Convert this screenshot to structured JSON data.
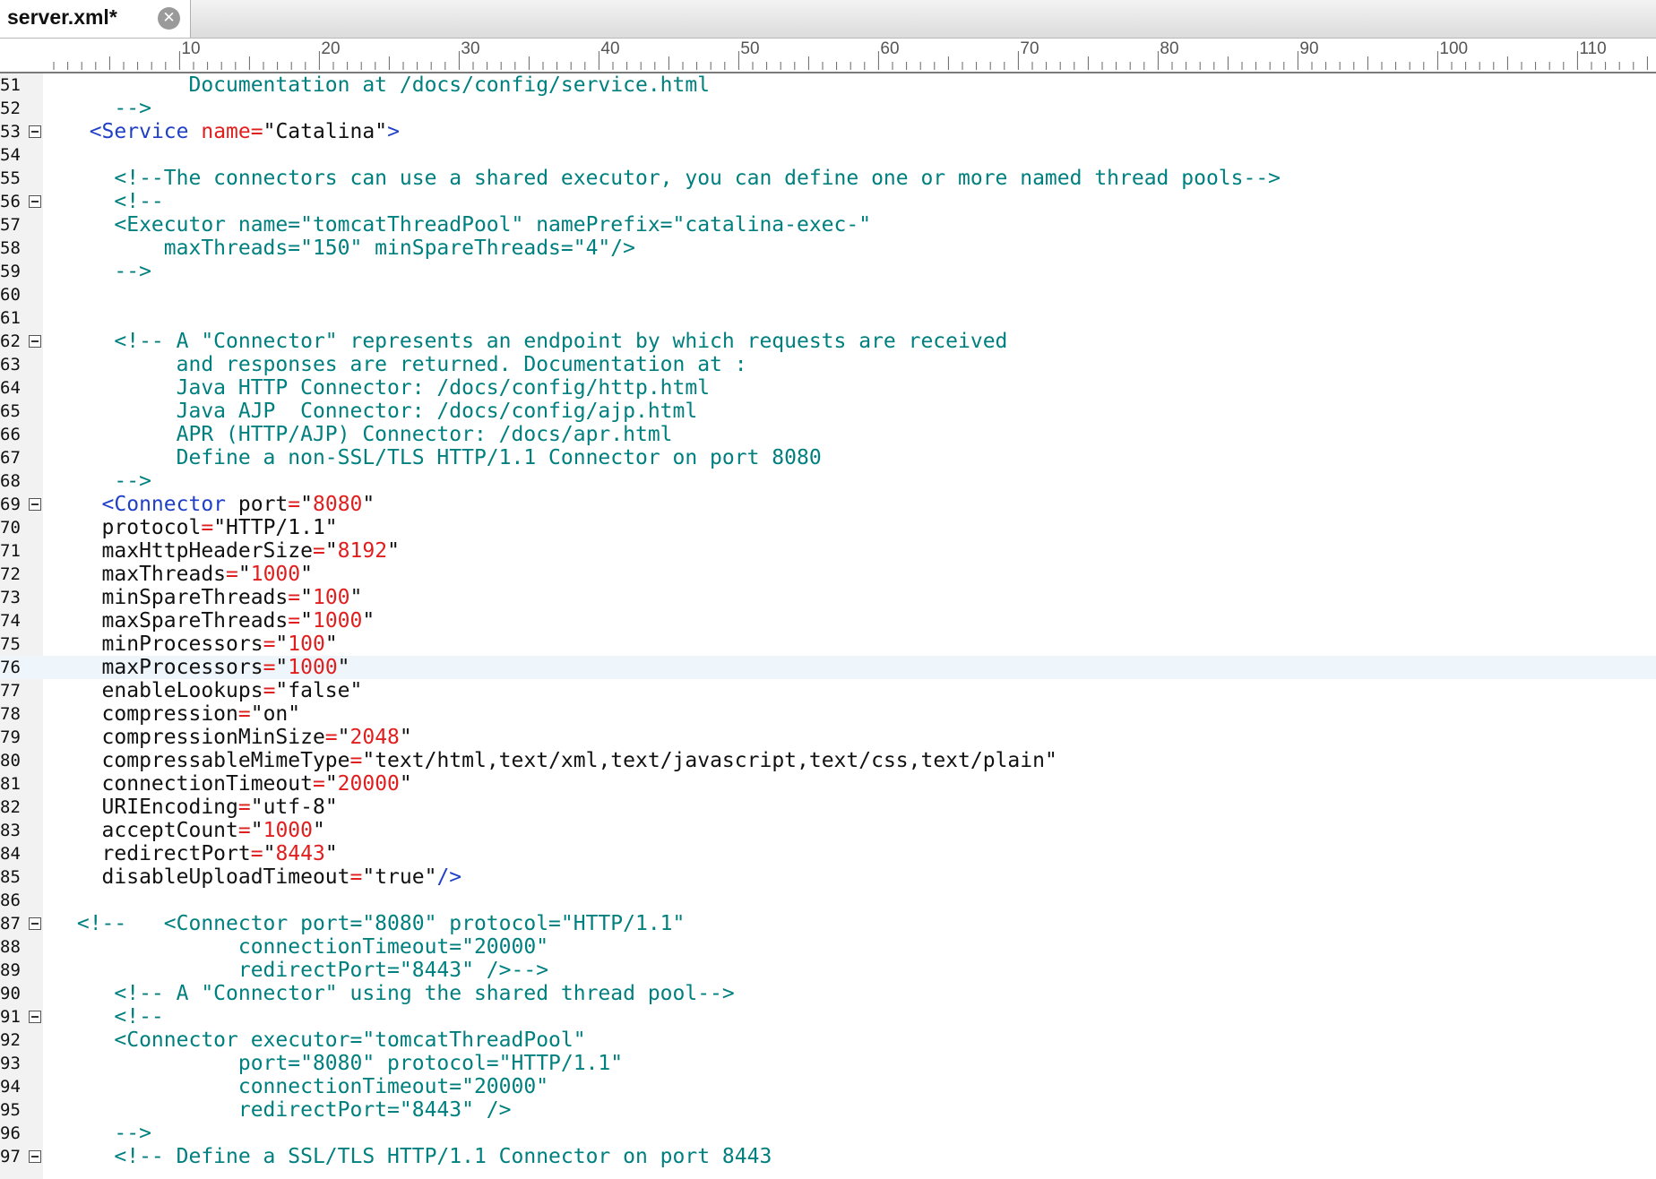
{
  "tab": {
    "title": "server.xml*",
    "close_icon": "close-icon"
  },
  "ruler": {
    "labels": [
      "10",
      "20",
      "30",
      "40",
      "50",
      "60",
      "70",
      "80",
      "90",
      "100",
      "110"
    ]
  },
  "colors": {
    "comment": "#007f7f",
    "tag": "#1f3fc7",
    "attribute_operator": "#e01e1e",
    "number": "#e01e1e",
    "text": "#111111",
    "current_line": "#eef6fb"
  },
  "editor": {
    "current_line": "76",
    "lines": [
      {
        "num": "51",
        "tokens": [
          {
            "t": "          Documentation at /docs/config/service.html",
            "c": "comment"
          }
        ]
      },
      {
        "num": "52",
        "tokens": [
          {
            "t": "    -->",
            "c": "comment"
          }
        ]
      },
      {
        "num": "53",
        "fold": true,
        "tokens": [
          {
            "t": "  ",
            "c": "text"
          },
          {
            "t": "<Service",
            "c": "tag"
          },
          {
            "t": " ",
            "c": "text"
          },
          {
            "t": "name",
            "c": "eq"
          },
          {
            "t": "=",
            "c": "eq"
          },
          {
            "t": "\"Catalina\"",
            "c": "str"
          },
          {
            "t": ">",
            "c": "tag"
          }
        ]
      },
      {
        "num": "54",
        "tokens": []
      },
      {
        "num": "55",
        "tokens": [
          {
            "t": "    <!--The connectors can use a shared executor, you can define one or more named thread pools-->",
            "c": "comment"
          }
        ]
      },
      {
        "num": "56",
        "fold": true,
        "tokens": [
          {
            "t": "    <!--",
            "c": "comment"
          }
        ]
      },
      {
        "num": "57",
        "tokens": [
          {
            "t": "    <Executor name=\"tomcatThreadPool\" namePrefix=\"catalina-exec-\"",
            "c": "comment"
          }
        ]
      },
      {
        "num": "58",
        "tokens": [
          {
            "t": "        maxThreads=\"150\" minSpareThreads=\"4\"/>",
            "c": "comment"
          }
        ]
      },
      {
        "num": "59",
        "tokens": [
          {
            "t": "    -->",
            "c": "comment"
          }
        ]
      },
      {
        "num": "60",
        "tokens": []
      },
      {
        "num": "61",
        "tokens": []
      },
      {
        "num": "62",
        "fold": true,
        "tokens": [
          {
            "t": "    <!-- A \"Connector\" represents an endpoint by which requests are received",
            "c": "comment"
          }
        ]
      },
      {
        "num": "63",
        "tokens": [
          {
            "t": "         and responses are returned. Documentation at :",
            "c": "comment"
          }
        ]
      },
      {
        "num": "64",
        "tokens": [
          {
            "t": "         Java HTTP Connector: /docs/config/http.html",
            "c": "comment"
          }
        ]
      },
      {
        "num": "65",
        "tokens": [
          {
            "t": "         Java AJP  Connector: /docs/config/ajp.html",
            "c": "comment"
          }
        ]
      },
      {
        "num": "66",
        "tokens": [
          {
            "t": "         APR (HTTP/AJP) Connector: /docs/apr.html",
            "c": "comment"
          }
        ]
      },
      {
        "num": "67",
        "tokens": [
          {
            "t": "         Define a non-SSL/TLS HTTP/1.1 Connector on port 8080",
            "c": "comment"
          }
        ]
      },
      {
        "num": "68",
        "tokens": [
          {
            "t": "    -->",
            "c": "comment"
          }
        ]
      },
      {
        "num": "69",
        "fold": true,
        "tokens": [
          {
            "t": "   ",
            "c": "text"
          },
          {
            "t": "<Connector",
            "c": "tag"
          },
          {
            "t": " port",
            "c": "attr"
          },
          {
            "t": "=",
            "c": "eq"
          },
          {
            "t": "\"",
            "c": "str"
          },
          {
            "t": "8080",
            "c": "num"
          },
          {
            "t": "\"",
            "c": "str"
          }
        ]
      },
      {
        "num": "70",
        "tokens": [
          {
            "t": "   protocol",
            "c": "attr"
          },
          {
            "t": "=",
            "c": "eq"
          },
          {
            "t": "\"HTTP/1.1\"",
            "c": "str"
          }
        ]
      },
      {
        "num": "71",
        "tokens": [
          {
            "t": "   maxHttpHeaderSize",
            "c": "attr"
          },
          {
            "t": "=",
            "c": "eq"
          },
          {
            "t": "\"",
            "c": "str"
          },
          {
            "t": "8192",
            "c": "num"
          },
          {
            "t": "\"",
            "c": "str"
          }
        ]
      },
      {
        "num": "72",
        "tokens": [
          {
            "t": "   maxThreads",
            "c": "attr"
          },
          {
            "t": "=",
            "c": "eq"
          },
          {
            "t": "\"",
            "c": "str"
          },
          {
            "t": "1000",
            "c": "num"
          },
          {
            "t": "\"",
            "c": "str"
          }
        ]
      },
      {
        "num": "73",
        "tokens": [
          {
            "t": "   minSpareThreads",
            "c": "attr"
          },
          {
            "t": "=",
            "c": "eq"
          },
          {
            "t": "\"",
            "c": "str"
          },
          {
            "t": "100",
            "c": "num"
          },
          {
            "t": "\"",
            "c": "str"
          }
        ]
      },
      {
        "num": "74",
        "tokens": [
          {
            "t": "   maxSpareThreads",
            "c": "attr"
          },
          {
            "t": "=",
            "c": "eq"
          },
          {
            "t": "\"",
            "c": "str"
          },
          {
            "t": "1000",
            "c": "num"
          },
          {
            "t": "\"",
            "c": "str"
          }
        ]
      },
      {
        "num": "75",
        "tokens": [
          {
            "t": "   minProcessors",
            "c": "attr"
          },
          {
            "t": "=",
            "c": "eq"
          },
          {
            "t": "\"",
            "c": "str"
          },
          {
            "t": "100",
            "c": "num"
          },
          {
            "t": "\"",
            "c": "str"
          }
        ]
      },
      {
        "num": "76",
        "tokens": [
          {
            "t": "   maxProcessors",
            "c": "attr"
          },
          {
            "t": "=",
            "c": "eq"
          },
          {
            "t": "\"",
            "c": "str"
          },
          {
            "t": "1000",
            "c": "num"
          },
          {
            "t": "\"",
            "c": "str"
          }
        ]
      },
      {
        "num": "77",
        "tokens": [
          {
            "t": "   enableLookups",
            "c": "attr"
          },
          {
            "t": "=",
            "c": "eq"
          },
          {
            "t": "\"false\"",
            "c": "str"
          }
        ]
      },
      {
        "num": "78",
        "tokens": [
          {
            "t": "   compression",
            "c": "attr"
          },
          {
            "t": "=",
            "c": "eq"
          },
          {
            "t": "\"on\"",
            "c": "str"
          }
        ]
      },
      {
        "num": "79",
        "tokens": [
          {
            "t": "   compressionMinSize",
            "c": "attr"
          },
          {
            "t": "=",
            "c": "eq"
          },
          {
            "t": "\"",
            "c": "str"
          },
          {
            "t": "2048",
            "c": "num"
          },
          {
            "t": "\"",
            "c": "str"
          }
        ]
      },
      {
        "num": "80",
        "tokens": [
          {
            "t": "   compressableMimeType",
            "c": "attr"
          },
          {
            "t": "=",
            "c": "eq"
          },
          {
            "t": "\"text/html,text/xml,text/javascript,text/css,text/plain\"",
            "c": "str"
          }
        ]
      },
      {
        "num": "81",
        "tokens": [
          {
            "t": "   connectionTimeout",
            "c": "attr"
          },
          {
            "t": "=",
            "c": "eq"
          },
          {
            "t": "\"",
            "c": "str"
          },
          {
            "t": "20000",
            "c": "num"
          },
          {
            "t": "\"",
            "c": "str"
          }
        ]
      },
      {
        "num": "82",
        "tokens": [
          {
            "t": "   URIEncoding",
            "c": "attr"
          },
          {
            "t": "=",
            "c": "eq"
          },
          {
            "t": "\"utf-8\"",
            "c": "str"
          }
        ]
      },
      {
        "num": "83",
        "tokens": [
          {
            "t": "   acceptCount",
            "c": "attr"
          },
          {
            "t": "=",
            "c": "eq"
          },
          {
            "t": "\"",
            "c": "str"
          },
          {
            "t": "1000",
            "c": "num"
          },
          {
            "t": "\"",
            "c": "str"
          }
        ]
      },
      {
        "num": "84",
        "tokens": [
          {
            "t": "   redirectPort",
            "c": "attr"
          },
          {
            "t": "=",
            "c": "eq"
          },
          {
            "t": "\"",
            "c": "str"
          },
          {
            "t": "8443",
            "c": "num"
          },
          {
            "t": "\"",
            "c": "str"
          }
        ]
      },
      {
        "num": "85",
        "tokens": [
          {
            "t": "   disableUploadTimeout",
            "c": "attr"
          },
          {
            "t": "=",
            "c": "eq"
          },
          {
            "t": "\"true\"",
            "c": "str"
          },
          {
            "t": "/>",
            "c": "tag"
          }
        ]
      },
      {
        "num": "86",
        "tokens": []
      },
      {
        "num": "87",
        "fold": true,
        "tokens": [
          {
            "t": " <!--   <Connector port=\"8080\" protocol=\"HTTP/1.1\"",
            "c": "comment"
          }
        ]
      },
      {
        "num": "88",
        "tokens": [
          {
            "t": "              connectionTimeout=\"20000\"",
            "c": "comment"
          }
        ]
      },
      {
        "num": "89",
        "tokens": [
          {
            "t": "              redirectPort=\"8443\" />-->",
            "c": "comment"
          }
        ]
      },
      {
        "num": "90",
        "tokens": [
          {
            "t": "    <!-- A \"Connector\" using the shared thread pool-->",
            "c": "comment"
          }
        ]
      },
      {
        "num": "91",
        "fold": true,
        "tokens": [
          {
            "t": "    <!--",
            "c": "comment"
          }
        ]
      },
      {
        "num": "92",
        "tokens": [
          {
            "t": "    <Connector executor=\"tomcatThreadPool\"",
            "c": "comment"
          }
        ]
      },
      {
        "num": "93",
        "tokens": [
          {
            "t": "              port=\"8080\" protocol=\"HTTP/1.1\"",
            "c": "comment"
          }
        ]
      },
      {
        "num": "94",
        "tokens": [
          {
            "t": "              connectionTimeout=\"20000\"",
            "c": "comment"
          }
        ]
      },
      {
        "num": "95",
        "tokens": [
          {
            "t": "              redirectPort=\"8443\" />",
            "c": "comment"
          }
        ]
      },
      {
        "num": "96",
        "tokens": [
          {
            "t": "    -->",
            "c": "comment"
          }
        ]
      },
      {
        "num": "97",
        "fold": true,
        "tokens": [
          {
            "t": "    <!-- Define a SSL/TLS HTTP/1.1 Connector on port 8443",
            "c": "comment"
          }
        ]
      }
    ]
  }
}
